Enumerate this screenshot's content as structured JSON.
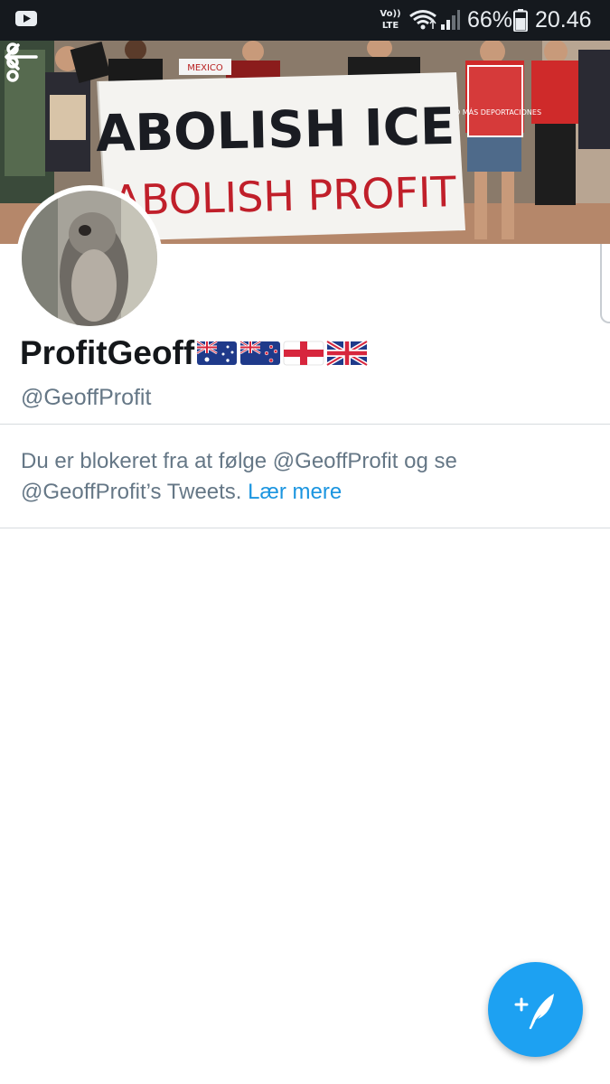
{
  "status_bar": {
    "volte_line1": "Vo))",
    "volte_line2": "LTE",
    "battery_percent": "66%",
    "time": "20.46"
  },
  "banner": {
    "sign_line1": "ABOLISH ICE",
    "sign_line2": "ABOLISH PROFIT",
    "small_sign": "NO MÁS DEPORTACIONES",
    "side_sign": "MEXICO"
  },
  "profile": {
    "display_name": "ProfitGeoff",
    "flags": [
      "australia-flag",
      "new-zealand-flag",
      "england-flag",
      "union-jack-flag"
    ],
    "handle": "@GeoffProfit"
  },
  "blocked_notice": {
    "message": "Du er blokeret fra at følge @GeoffProfit og se @GeoffProfit’s Tweets.",
    "link_label": "Lær mere"
  },
  "icons": {
    "back": "arrow-left-icon",
    "more": "more-vertical-icon",
    "compose": "compose-tweet-icon"
  },
  "colors": {
    "accent": "#1da1f2",
    "link": "#1b95e0",
    "status_bar": "#15191e",
    "text_primary": "#14171a",
    "text_secondary": "#657786"
  }
}
